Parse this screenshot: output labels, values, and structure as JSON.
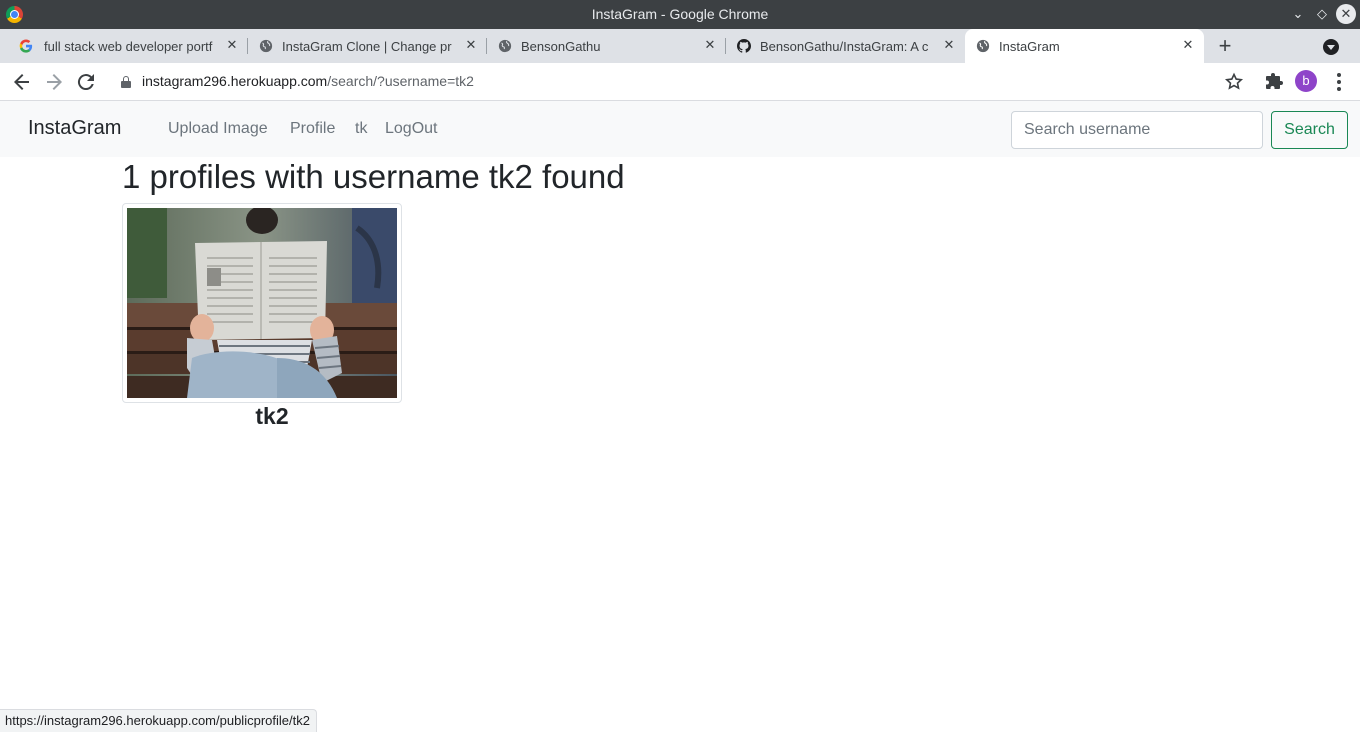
{
  "window": {
    "title": "InstaGram - Google Chrome"
  },
  "tabs": [
    {
      "label": "full stack web developer portf",
      "favicon": "google-icon"
    },
    {
      "label": "InstaGram Clone | Change pr",
      "favicon": "globe-icon"
    },
    {
      "label": "BensonGathu",
      "favicon": "globe-icon"
    },
    {
      "label": "BensonGathu/InstaGram: A c",
      "favicon": "github-icon"
    },
    {
      "label": "InstaGram",
      "favicon": "globe-icon",
      "active": true
    }
  ],
  "toolbar": {
    "url_host": "instagram296.herokuapp.com",
    "url_path": "/search/?username=tk2",
    "avatar_letter": "b"
  },
  "navbar": {
    "brand": "InstaGram",
    "links": [
      "Upload Image",
      "Profile",
      "tk",
      "LogOut"
    ],
    "search_placeholder": "Search username",
    "search_button": "Search"
  },
  "main": {
    "heading": "1 profiles with username tk2 found",
    "results": [
      {
        "username": "tk2"
      }
    ]
  },
  "statusbar": {
    "url": "https://instagram296.herokuapp.com/publicprofile/tk2"
  },
  "colors": {
    "search_button": "#198754",
    "navbar_bg": "#f8f9fa",
    "titlebar_bg": "#3c4043",
    "tabstrip_bg": "#dee1e6",
    "avatar_bg": "#8e44c9"
  }
}
